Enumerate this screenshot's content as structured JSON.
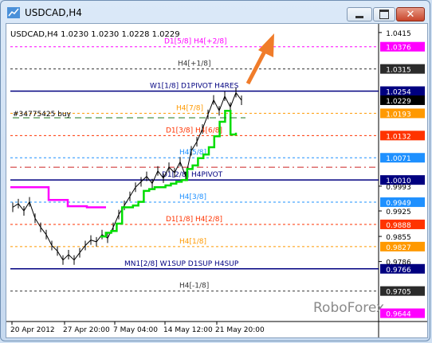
{
  "window": {
    "title": "USDCAD,H4",
    "minimize_icon": "minimize-icon",
    "maximize_icon": "maximize-icon",
    "close_icon": "close-icon"
  },
  "chart": {
    "symbol_info": "USDCAD,H4  1.0230 1.0230 1.0228 1.0229",
    "order_label": "#34775425 buy",
    "watermark": "RoboForex",
    "accent_colors": {
      "bull_line": "#00dd00",
      "band": "#ff00ff",
      "arrow": "#f07c2a",
      "navy": "#000080"
    }
  },
  "chart_data": {
    "type": "line",
    "y_ticks": [
      "1.0415",
      "1.0376",
      "1.0315",
      "1.0254",
      "1.0229",
      "1.0193",
      "1.0132",
      "1.0071",
      "1.0010",
      "0.9993",
      "0.9949",
      "0.9925",
      "0.9888",
      "0.9855",
      "0.9827",
      "0.9786",
      "0.9766",
      "0.9705",
      "0.9644"
    ],
    "x_ticks": [
      "20 Apr 2012",
      "27 Apr 20:00",
      "7 May 04:00",
      "14 May 12:00",
      "21 May 20:00"
    ],
    "levels": [
      {
        "label": "D1[5/8] H4[+2/8]",
        "value": 1.0376,
        "color": "#ff00ff"
      },
      {
        "label": "H4[+1/8]",
        "value": 1.0315,
        "color": "#333333"
      },
      {
        "label": "W1[1/8] D1PIVOT H4RES",
        "value": 1.0254,
        "color": "#000080"
      },
      {
        "label": "H4[7/8]",
        "value": 1.0193,
        "color": "#ff9900"
      },
      {
        "label": "D1[3/8] H4[6/8]",
        "value": 1.0132,
        "color": "#ff3300"
      },
      {
        "label": "H4[5/8]",
        "value": 1.0071,
        "color": "#1e90ff"
      },
      {
        "label": "D1[2/8] H4PIVOT",
        "value": 1.001,
        "color": "#000080"
      },
      {
        "label": "H4[3/8]",
        "value": 0.9949,
        "color": "#1e90ff"
      },
      {
        "label": "D1[1/8] H4[2/8]",
        "value": 0.9888,
        "color": "#ff3300"
      },
      {
        "label": "H4[1/8]",
        "value": 0.9827,
        "color": "#ff9900"
      },
      {
        "label": "MN1[2/8] W1SUP D1SUP H4SUP",
        "value": 0.9766,
        "color": "#000080"
      },
      {
        "label": "H4[-1/8]",
        "value": 0.9705,
        "color": "#333333"
      }
    ],
    "price_badges": [
      {
        "text": "1.0376",
        "bg": "#ff00ff",
        "fg": "#ffffff"
      },
      {
        "text": "1.0315",
        "bg": "#2b2b2b",
        "fg": "#ffffff"
      },
      {
        "text": "1.0254",
        "bg": "#000080",
        "fg": "#ffffff"
      },
      {
        "text": "1.0229",
        "bg": "#000000",
        "fg": "#ffffff"
      },
      {
        "text": "1.0193",
        "bg": "#ff9900",
        "fg": "#ffffff"
      },
      {
        "text": "1.0132",
        "bg": "#ff3300",
        "fg": "#ffffff"
      },
      {
        "text": "1.0071",
        "bg": "#1e90ff",
        "fg": "#ffffff"
      },
      {
        "text": "1.0010",
        "bg": "#000080",
        "fg": "#ffffff"
      },
      {
        "text": "0.9949",
        "bg": "#1e90ff",
        "fg": "#ffffff"
      },
      {
        "text": "0.9888",
        "bg": "#ff3300",
        "fg": "#ffffff"
      },
      {
        "text": "0.9827",
        "bg": "#ff9900",
        "fg": "#ffffff"
      },
      {
        "text": "0.9766",
        "bg": "#000080",
        "fg": "#ffffff"
      },
      {
        "text": "0.9705",
        "bg": "#2b2b2b",
        "fg": "#ffffff"
      },
      {
        "text": "0.9644",
        "bg": "#ff00ff",
        "fg": "#ffffff"
      }
    ],
    "plain_ticks": [
      "1.0415",
      "0.9993",
      "0.9925",
      "0.9855",
      "0.9786"
    ],
    "price_series": [
      0.9935,
      0.9945,
      0.9925,
      0.995,
      0.9905,
      0.988,
      0.986,
      0.983,
      0.9815,
      0.979,
      0.9805,
      0.979,
      0.981,
      0.983,
      0.9845,
      0.984,
      0.986,
      0.985,
      0.988,
      0.9915,
      0.994,
      0.9965,
      0.999,
      1.0005,
      1.002,
      1.0,
      1.0035,
      1.0015,
      1.0045,
      1.003,
      1.006,
      1.002,
      1.009,
      1.0115,
      1.015,
      1.019,
      1.023,
      1.02,
      1.024,
      1.021,
      1.025,
      1.0229
    ],
    "green_steps": [
      0.9855,
      0.9865,
      0.987,
      0.989,
      0.9935,
      0.9935,
      0.994,
      0.995,
      0.998,
      0.9985,
      0.999,
      0.999,
      0.9995,
      1.0,
      1.0005,
      1.001,
      1.004,
      1.005,
      1.007,
      1.008,
      1.01,
      1.013,
      1.017,
      1.02,
      1.0135,
      1.014
    ],
    "magenta_steps": [
      0.999,
      0.999,
      0.9955,
      0.9938,
      0.9935,
      0.9935
    ],
    "ylim": [
      0.963,
      1.043
    ]
  }
}
